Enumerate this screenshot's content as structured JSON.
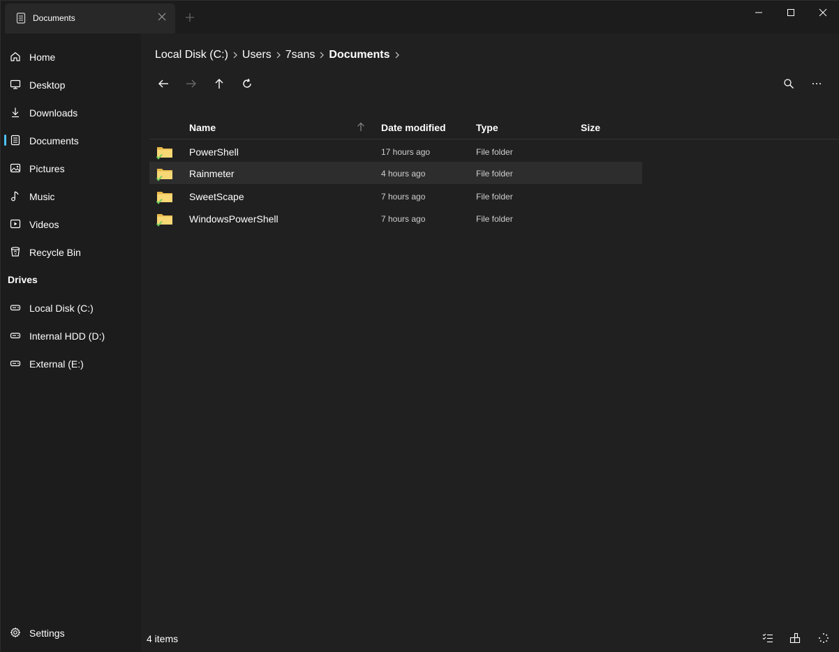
{
  "titlebar": {
    "tab_title": "Documents",
    "new_tab_icon": "plus-icon",
    "buttons": [
      "minimize-icon",
      "maximize-icon",
      "close-icon"
    ]
  },
  "sidebar": {
    "items": [
      {
        "label": "Home",
        "icon": "home-icon"
      },
      {
        "label": "Desktop",
        "icon": "desktop-icon"
      },
      {
        "label": "Downloads",
        "icon": "download-icon"
      },
      {
        "label": "Documents",
        "icon": "document-icon",
        "active": true
      },
      {
        "label": "Pictures",
        "icon": "picture-icon"
      },
      {
        "label": "Music",
        "icon": "music-icon"
      },
      {
        "label": "Videos",
        "icon": "video-icon"
      },
      {
        "label": "Recycle Bin",
        "icon": "recycle-bin-icon"
      }
    ],
    "drives_header": "Drives",
    "drives": [
      {
        "label": "Local Disk (C:)",
        "icon": "drive-icon"
      },
      {
        "label": "Internal HDD (D:)",
        "icon": "drive-icon"
      },
      {
        "label": "External (E:)",
        "icon": "drive-icon"
      }
    ],
    "settings_label": "Settings"
  },
  "breadcrumb": [
    "Local Disk (C:)",
    "Users",
    "7sans",
    "Documents"
  ],
  "toolbar": [
    "back-arrow-icon",
    "forward-arrow-icon",
    "up-arrow-icon",
    "refresh-icon",
    "search-icon",
    "more-icon"
  ],
  "columns": {
    "name": "Name",
    "date": "Date modified",
    "type": "Type",
    "size": "Size",
    "sort_icon": "sort-ascending-icon"
  },
  "files": [
    {
      "name": "PowerShell",
      "date": "17 hours ago",
      "type": "File folder"
    },
    {
      "name": "Rainmeter",
      "date": "4 hours ago",
      "type": "File folder",
      "selected": true
    },
    {
      "name": "SweetScape",
      "date": "7 hours ago",
      "type": "File folder"
    },
    {
      "name": "WindowsPowerShell",
      "date": "7 hours ago",
      "type": "File folder"
    }
  ],
  "status": {
    "item_count": "4 items",
    "icons": [
      "multi-select-icon",
      "layout-icon",
      "loading-icon"
    ]
  },
  "colors": {
    "accent": "#4cc2ff",
    "folder": "#f8d775",
    "sync_check": "#6ccb5f"
  }
}
